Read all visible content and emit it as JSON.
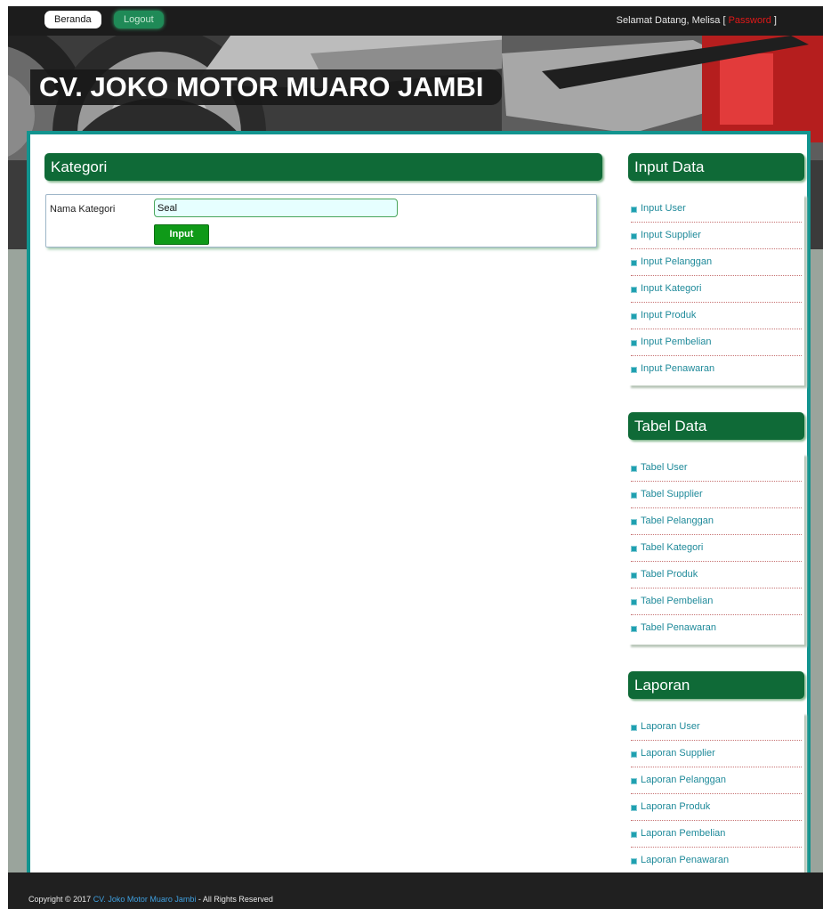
{
  "topbar": {
    "home_label": "Beranda",
    "logout_label": "Logout",
    "greeting_prefix": "Selamat Datang, Melisa [ ",
    "password_label": "Password",
    "greeting_suffix": " ]"
  },
  "banner": {
    "brand": "CV. JOKO MOTOR MUARO JAMBI"
  },
  "main": {
    "section_title": "Kategori",
    "form": {
      "field_label": "Nama Kategori",
      "field_value": "Seal",
      "submit_label": "Input"
    }
  },
  "sidebar": {
    "input": {
      "title": "Input Data",
      "items": [
        "Input User",
        "Input Supplier",
        "Input Pelanggan",
        "Input Kategori",
        "Input Produk",
        "Input Pembelian",
        "Input Penawaran"
      ]
    },
    "table": {
      "title": "Tabel Data",
      "items": [
        "Tabel User",
        "Tabel Supplier",
        "Tabel Pelanggan",
        "Tabel Kategori",
        "Tabel Produk",
        "Tabel Pembelian",
        "Tabel Penawaran"
      ]
    },
    "report": {
      "title": "Laporan",
      "items": [
        "Laporan User",
        "Laporan Supplier",
        "Laporan Pelanggan",
        "Laporan Produk",
        "Laporan Pembelian",
        "Laporan Penawaran"
      ]
    }
  },
  "footer": {
    "prefix": "Copyright © 2017 ",
    "link": "CV. Joko Motor Muaro Jambi",
    "suffix": " - All Rights Reserved"
  },
  "colors": {
    "accent_green": "#0f6a37",
    "frame_teal": "#12948f",
    "button_green": "#0f9a18",
    "link_teal": "#1f8a9a"
  }
}
